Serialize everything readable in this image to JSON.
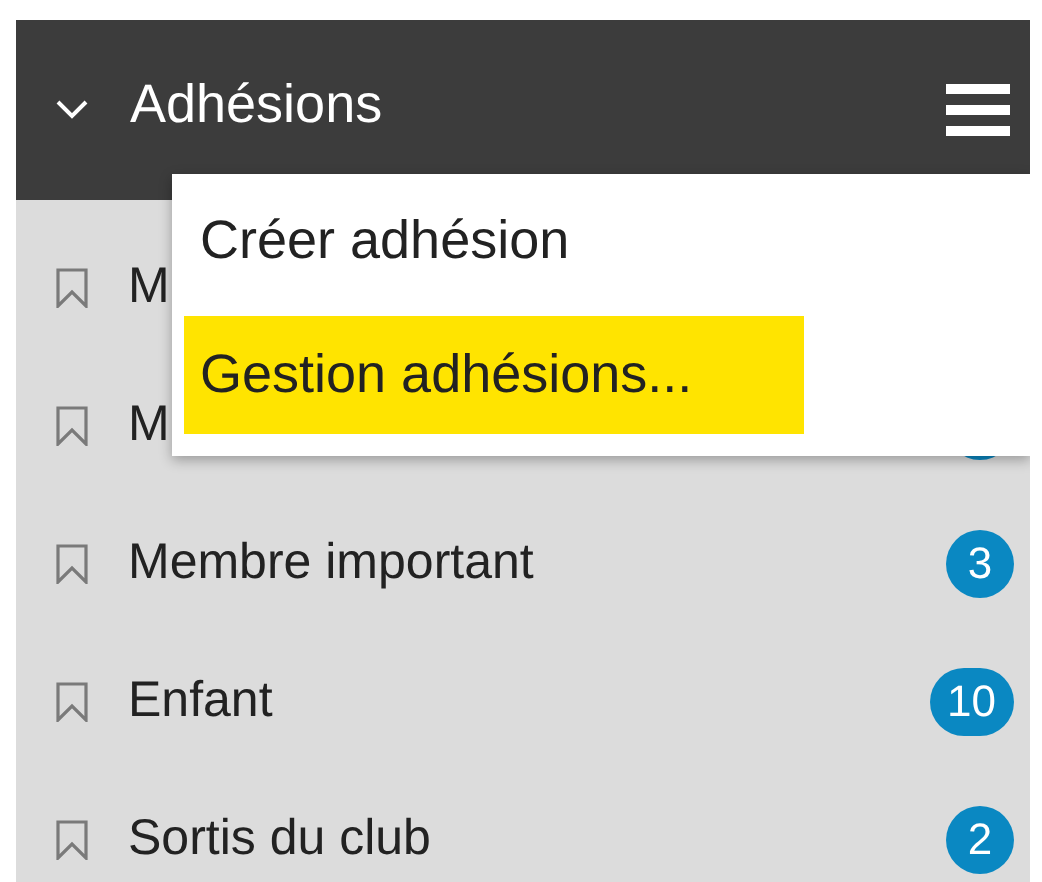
{
  "header": {
    "title": "Adhésions",
    "expanded": true
  },
  "menu": [
    {
      "label": "Créer adhésion",
      "selected": false
    },
    {
      "label": "Gestion adhésions...",
      "selected": true
    }
  ],
  "items": [
    {
      "label": "M"
    },
    {
      "label": "M",
      "badge": true
    },
    {
      "label": "Membre important",
      "count": "3"
    },
    {
      "label": "Enfant",
      "count": "10"
    },
    {
      "label": "Sortis du club",
      "count": "2"
    }
  ]
}
